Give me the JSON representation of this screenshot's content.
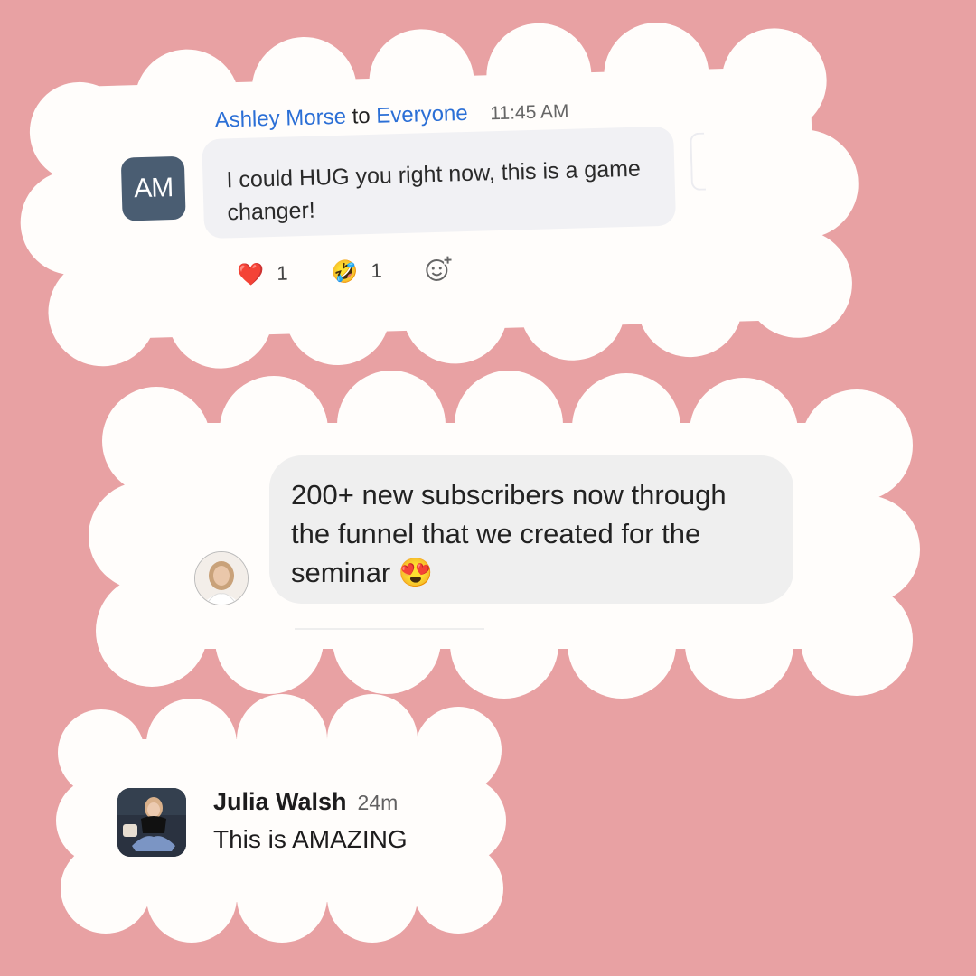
{
  "colors": {
    "background": "#e8a1a3",
    "cloud": "#fffdfb",
    "zoom_link_blue": "#2b6fd6",
    "am_avatar": "#4a5d72"
  },
  "zoom_message": {
    "avatar_initials": "AM",
    "sender": "Ashley Morse",
    "to_word": "to",
    "recipient": "Everyone",
    "time": "11:45 AM",
    "text": "I could HUG you right now, this is a game changer!",
    "reactions": [
      {
        "emoji": "❤️",
        "count": "1",
        "icon": "heart-emoji"
      },
      {
        "emoji": "🤣",
        "count": "1",
        "icon": "rofl-emoji"
      }
    ],
    "add_reaction_icon": "add-reaction-icon"
  },
  "messenger_message": {
    "text": "200+ new subscribers now through the funnel that we created for the seminar 😍",
    "avatar_icon": "profile-photo"
  },
  "slack_message": {
    "name": "Julia Walsh",
    "time": "24m",
    "text": "This is AMAZING",
    "avatar_icon": "profile-photo"
  }
}
